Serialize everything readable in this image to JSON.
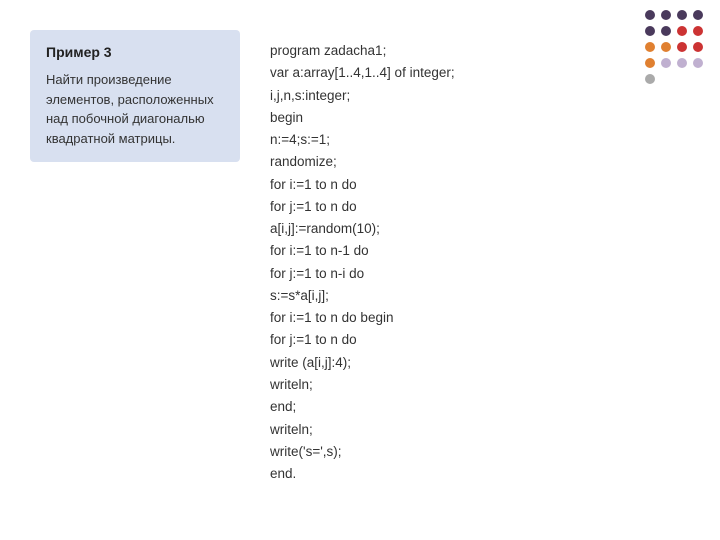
{
  "left_panel": {
    "title": "Пример 3",
    "description": "Найти произведение элементов, расположенных над побочной диагональю квадратной матрицы."
  },
  "code": {
    "lines": [
      "program zadacha1;",
      "var a:array[1..4,1..4] of integer;",
      "i,j,n,s:integer;",
      "begin",
      "n:=4;s:=1;",
      "randomize;",
      "for i:=1 to n do",
      "for j:=1 to n do",
      "a[i,j]:=random(10);",
      "for i:=1 to n-1 do",
      "for j:=1 to n-i do",
      "s:=s*a[i,j];",
      "for i:=1 to n do begin",
      "for j:=1 to n do",
      "write (a[i,j]:4);",
      "writeln;",
      "end;",
      "writeln;",
      "write('s=',s);",
      "end."
    ]
  },
  "dots": {
    "pattern": [
      [
        "dark",
        "dark",
        "dark",
        "dark"
      ],
      [
        "dark",
        "dark",
        "red",
        "red"
      ],
      [
        "orange",
        "orange",
        "red",
        "red"
      ],
      [
        "orange",
        "light",
        "light",
        "light"
      ],
      [
        "gray",
        "hidden",
        "hidden",
        "hidden"
      ]
    ]
  }
}
